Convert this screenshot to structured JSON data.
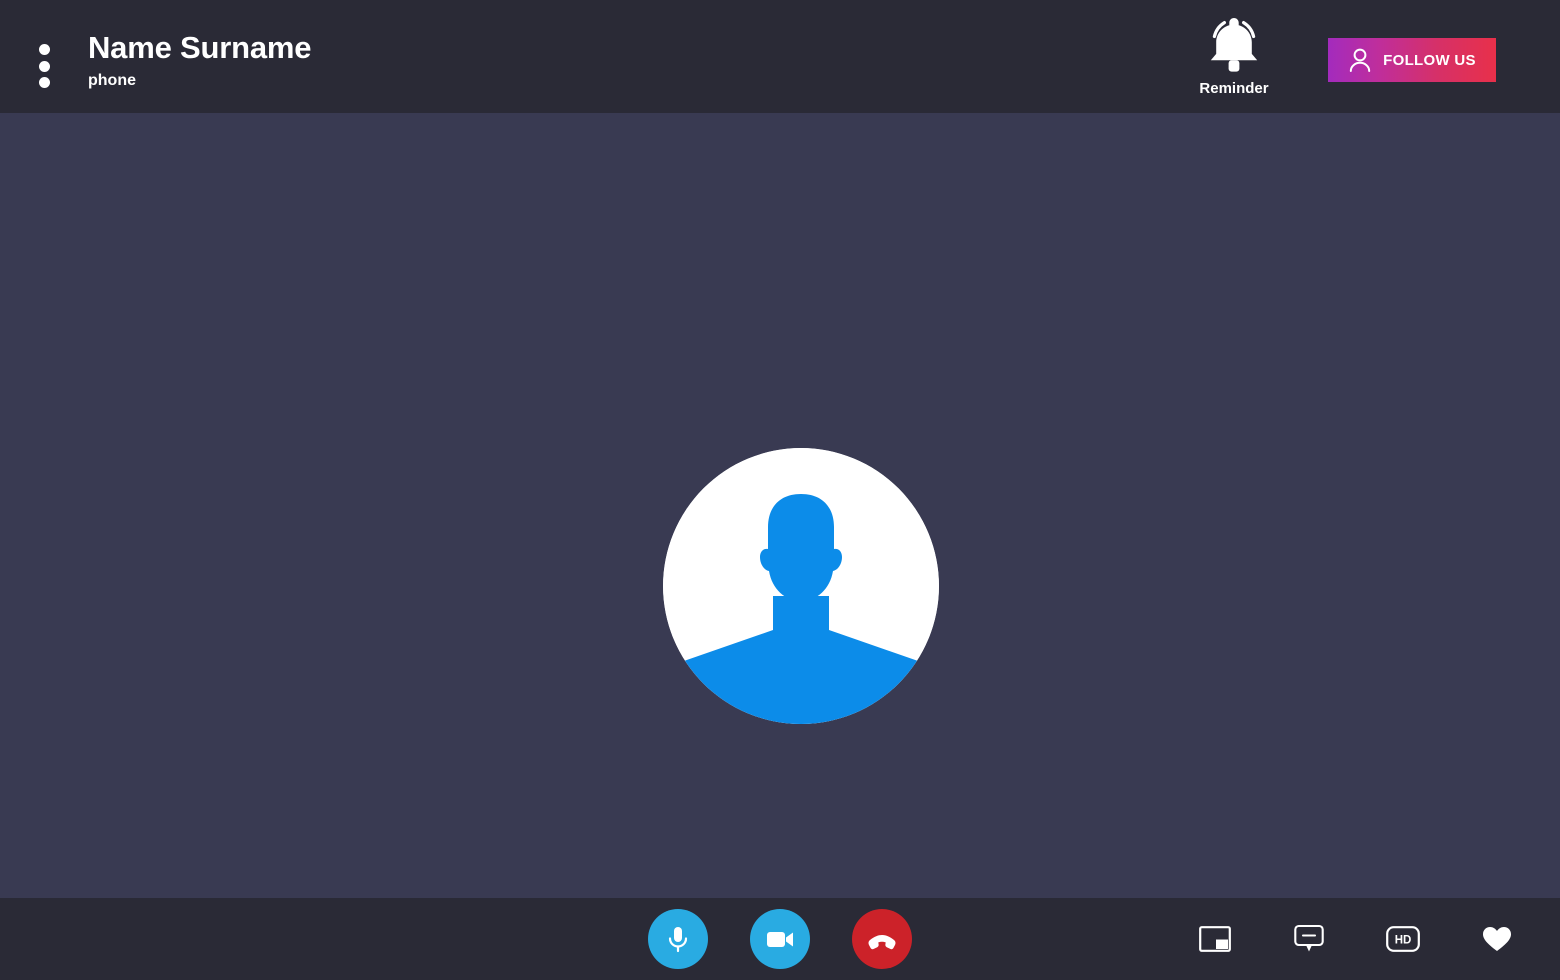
{
  "header": {
    "menu_icon": "kebab-menu-icon",
    "caller_name": "Name Surname",
    "call_type": "phone",
    "reminder": {
      "icon": "bell-ring-icon",
      "label": "Reminder"
    },
    "follow_button": {
      "icon": "person-outline-icon",
      "label": "FOLLOW US",
      "gradient_from": "#a32bbd",
      "gradient_to": "#e8304a"
    }
  },
  "stage": {
    "avatar": {
      "icon": "user-avatar-placeholder-icon",
      "circle_color": "#ffffff",
      "silhouette_color": "#0c8ce9"
    },
    "background_color": "#393a52"
  },
  "controlbar": {
    "background_color": "#2a2a36",
    "call_actions": [
      {
        "name": "microphone-button",
        "icon": "microphone-icon",
        "color": "#29abe2"
      },
      {
        "name": "video-camera-button",
        "icon": "video-camera-icon",
        "color": "#29abe2"
      },
      {
        "name": "end-call-button",
        "icon": "hang-up-phone-icon",
        "color": "#cc2229"
      }
    ],
    "util_actions": [
      {
        "name": "picture-in-picture-button",
        "icon": "picture-in-picture-icon",
        "label": ""
      },
      {
        "name": "chat-button",
        "icon": "chat-bubble-icon",
        "label": ""
      },
      {
        "name": "hd-quality-button",
        "icon": "hd-badge-icon",
        "label": "HD"
      },
      {
        "name": "favorite-button",
        "icon": "heart-icon",
        "label": ""
      }
    ]
  }
}
